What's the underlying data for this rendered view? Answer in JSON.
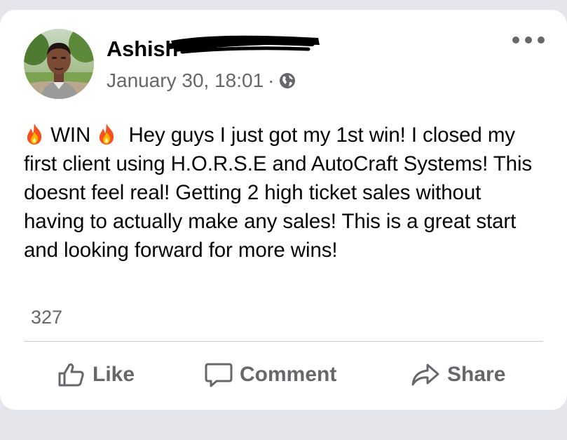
{
  "post": {
    "author": "Ashish",
    "timestamp": "January 30, 18:01",
    "separator": "·",
    "privacy_icon": "globe-icon",
    "more_icon": "more-options-icon",
    "tag": "WIN",
    "text": "Hey guys I just got my 1st win! I closed my first client using H.O.R.S.E and AutoCraft Systems! This doesnt feel real! Getting 2 high ticket sales without having to actually make any sales! This is a great start and looking forward for more wins!",
    "reaction_count": "327"
  },
  "actions": {
    "like_label": "Like",
    "comment_label": "Comment",
    "share_label": "Share"
  },
  "colors": {
    "page_background": "#e4e6eb",
    "card_background": "#ffffff",
    "primary_text": "#050505",
    "secondary_text": "#65676b",
    "divider": "#c8cbd0"
  }
}
